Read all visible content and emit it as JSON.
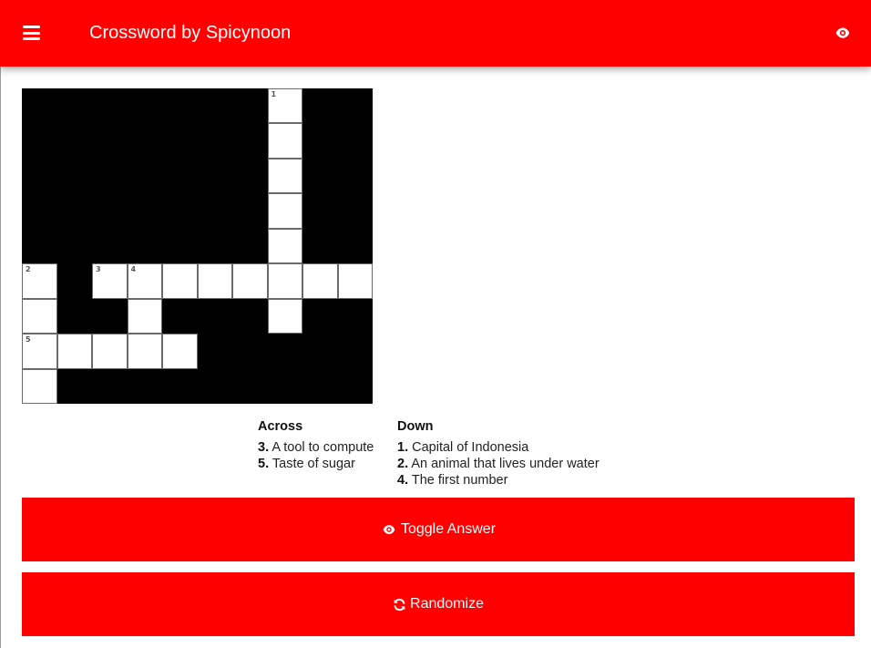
{
  "header": {
    "title": "Crossword by Spicynoon",
    "background": "#ff0000"
  },
  "crossword": {
    "columns": 10,
    "rows": 9,
    "open_cells": [
      {
        "row": 0,
        "col": 7,
        "number": "1"
      },
      {
        "row": 1,
        "col": 7
      },
      {
        "row": 2,
        "col": 7
      },
      {
        "row": 3,
        "col": 7
      },
      {
        "row": 4,
        "col": 7
      },
      {
        "row": 5,
        "col": 0,
        "number": "2"
      },
      {
        "row": 5,
        "col": 2,
        "number": "3"
      },
      {
        "row": 5,
        "col": 3,
        "number": "4"
      },
      {
        "row": 5,
        "col": 4
      },
      {
        "row": 5,
        "col": 5
      },
      {
        "row": 5,
        "col": 6
      },
      {
        "row": 5,
        "col": 7
      },
      {
        "row": 5,
        "col": 8
      },
      {
        "row": 5,
        "col": 9
      },
      {
        "row": 6,
        "col": 0
      },
      {
        "row": 6,
        "col": 3
      },
      {
        "row": 6,
        "col": 7
      },
      {
        "row": 7,
        "col": 0,
        "number": "5"
      },
      {
        "row": 7,
        "col": 1
      },
      {
        "row": 7,
        "col": 2
      },
      {
        "row": 7,
        "col": 3
      },
      {
        "row": 7,
        "col": 4
      },
      {
        "row": 8,
        "col": 0
      }
    ]
  },
  "clues": {
    "across_heading": "Across",
    "down_heading": "Down",
    "across": [
      {
        "number": "3.",
        "text": "A tool to compute"
      },
      {
        "number": "5.",
        "text": "Taste of sugar"
      }
    ],
    "down": [
      {
        "number": "1.",
        "text": "Capital of Indonesia"
      },
      {
        "number": "2.",
        "text": "An animal that lives under water"
      },
      {
        "number": "4.",
        "text": "The first number"
      }
    ]
  },
  "buttons": {
    "toggle_answer": {
      "label": "Toggle Answer",
      "icon": "eye-icon"
    },
    "randomize": {
      "label": "Randomize",
      "icon": "refresh-icon"
    }
  }
}
